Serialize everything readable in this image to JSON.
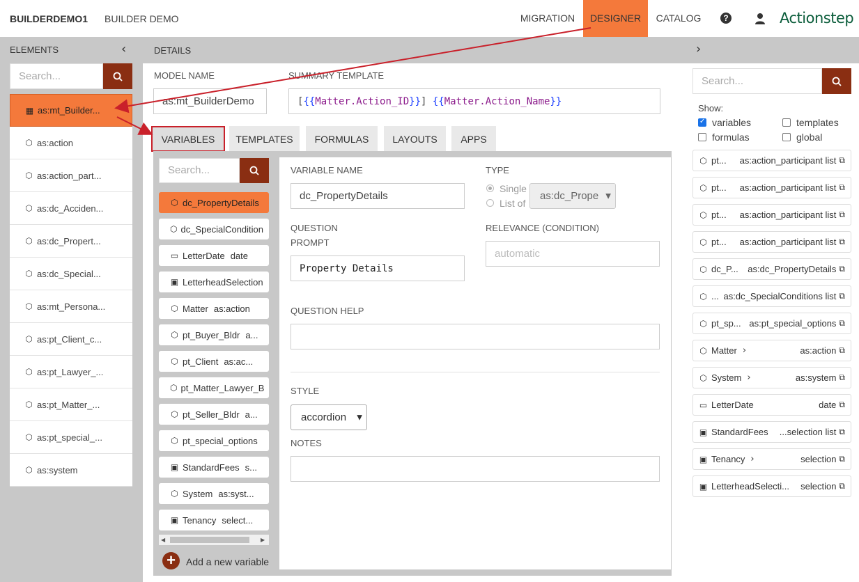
{
  "header": {
    "org": "BUILDERDEMO1",
    "app": "BUILDER DEMO",
    "nav": [
      "MIGRATION",
      "DESIGNER",
      "CATALOG"
    ],
    "logo": "Actionstep"
  },
  "elements_panel": {
    "title": "ELEMENTS",
    "search_placeholder": "Search...",
    "items": [
      {
        "label": "as:mt_Builder...",
        "icon": "grid-icon",
        "active": true
      },
      {
        "label": "as:action",
        "icon": "cube-icon"
      },
      {
        "label": "as:action_part...",
        "icon": "cube-icon"
      },
      {
        "label": "as:dc_Acciden...",
        "icon": "cube-icon"
      },
      {
        "label": "as:dc_Propert...",
        "icon": "cube-icon"
      },
      {
        "label": "as:dc_Special...",
        "icon": "cube-icon"
      },
      {
        "label": "as:mt_Persona...",
        "icon": "cube-icon"
      },
      {
        "label": "as:pt_Client_c...",
        "icon": "cube-icon"
      },
      {
        "label": "as:pt_Lawyer_...",
        "icon": "cube-icon"
      },
      {
        "label": "as:pt_Matter_...",
        "icon": "cube-icon"
      },
      {
        "label": "as:pt_special_...",
        "icon": "cube-icon"
      },
      {
        "label": "as:system",
        "icon": "cube-icon"
      }
    ]
  },
  "details": {
    "title": "DETAILS",
    "model_name_label": "MODEL NAME",
    "model_name_value": "as:mt_BuilderDemo",
    "summary_label": "SUMMARY TEMPLATE",
    "summary_value": {
      "p1": "[",
      "p2": "{{",
      "p3": "Matter.Action_ID",
      "p4": "}}",
      "p5": "] ",
      "p6": "{{",
      "p7": "Matter.Action_Name",
      "p8": "}}"
    },
    "tabs": [
      "VARIABLES",
      "TEMPLATES",
      "FORMULAS",
      "LAYOUTS",
      "APPS"
    ],
    "active_tab": "VARIABLES"
  },
  "variables": {
    "search_placeholder": "Search...",
    "items": [
      {
        "name": "dc_PropertyDetails",
        "type": "",
        "icon": "cube-icon",
        "active": true
      },
      {
        "name": "dc_SpecialCondition",
        "type": "",
        "icon": "cube-icon"
      },
      {
        "name": "LetterDate",
        "type": "date",
        "icon": "calendar-icon"
      },
      {
        "name": "LetterheadSelection",
        "type": "",
        "icon": "selection-icon"
      },
      {
        "name": "Matter",
        "type": "as:action",
        "icon": "cube-icon"
      },
      {
        "name": "pt_Buyer_Bldr",
        "type": "a...",
        "icon": "cube-icon"
      },
      {
        "name": "pt_Client",
        "type": "as:ac...",
        "icon": "cube-icon"
      },
      {
        "name": "pt_Matter_Lawyer_B",
        "type": "",
        "icon": "cube-icon"
      },
      {
        "name": "pt_Seller_Bldr",
        "type": "a...",
        "icon": "cube-icon"
      },
      {
        "name": "pt_special_options",
        "type": "",
        "icon": "cube-icon"
      },
      {
        "name": "StandardFees",
        "type": "s...",
        "icon": "selection-icon"
      },
      {
        "name": "System",
        "type": "as:syst...",
        "icon": "cube-icon"
      },
      {
        "name": "Tenancy",
        "type": "select...",
        "icon": "selection-icon"
      }
    ],
    "add_label": "Add a new variable"
  },
  "variable_form": {
    "name_label": "VARIABLE NAME",
    "name_value": "dc_PropertyDetails",
    "type_label": "TYPE",
    "type_single": "Single",
    "type_list": "List of",
    "type_select": "as:dc_Prope",
    "question_label_1": "QUESTION",
    "question_label_2": "PROMPT",
    "question_value": "Property Details",
    "relevance_label": "RELEVANCE (CONDITION)",
    "relevance_placeholder": "automatic",
    "help_label": "QUESTION HELP",
    "style_label": "STYLE",
    "style_value": "accordion",
    "notes_label": "NOTES"
  },
  "right_panel": {
    "search_placeholder": "Search...",
    "show_label": "Show:",
    "filters": [
      {
        "label": "variables",
        "checked": true
      },
      {
        "label": "templates",
        "checked": false
      },
      {
        "label": "formulas",
        "checked": false
      },
      {
        "label": "global",
        "checked": false
      }
    ],
    "items": [
      {
        "name": "pt...",
        "type": "as:action_participant list",
        "icon": "cube-icon",
        "chevron": false
      },
      {
        "name": "pt...",
        "type": "as:action_participant list",
        "icon": "cube-icon",
        "chevron": false
      },
      {
        "name": "pt...",
        "type": "as:action_participant list",
        "icon": "cube-icon",
        "chevron": false
      },
      {
        "name": "pt...",
        "type": "as:action_participant list",
        "icon": "cube-icon",
        "chevron": false
      },
      {
        "name": "dc_P...",
        "type": "as:dc_PropertyDetails",
        "icon": "cube-icon",
        "chevron": false
      },
      {
        "name": "...",
        "type": "as:dc_SpecialConditions list",
        "icon": "cube-icon",
        "chevron": false
      },
      {
        "name": "pt_sp...",
        "type": "as:pt_special_options",
        "icon": "cube-icon",
        "chevron": false
      },
      {
        "name": "Matter",
        "type": "as:action",
        "icon": "cube-icon",
        "chevron": true
      },
      {
        "name": "System",
        "type": "as:system",
        "icon": "cube-icon",
        "chevron": true
      },
      {
        "name": "LetterDate",
        "type": "date",
        "icon": "calendar-icon",
        "chevron": false
      },
      {
        "name": "StandardFees",
        "type": "...selection list",
        "icon": "selection-icon",
        "chevron": false
      },
      {
        "name": "Tenancy",
        "type": "selection",
        "icon": "selection-icon",
        "chevron": true
      },
      {
        "name": "LetterheadSelecti...",
        "type": "selection",
        "icon": "selection-icon",
        "chevron": false
      }
    ]
  },
  "colors": {
    "accent": "#f4793b",
    "button": "#8a2e12",
    "annotation": "#c9202a",
    "logo": "#0b5d3b"
  }
}
